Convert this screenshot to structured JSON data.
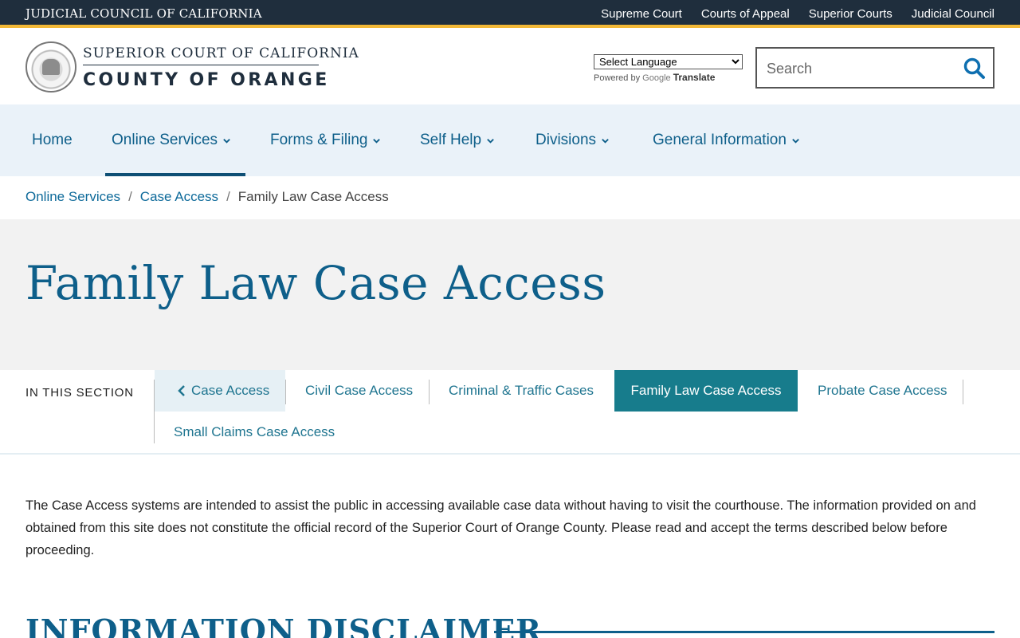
{
  "topbar": {
    "brand": "JUDICIAL COUNCIL OF CALIFORNIA",
    "links": [
      "Supreme Court",
      "Courts of Appeal",
      "Superior Courts",
      "Judicial Council"
    ]
  },
  "header": {
    "court_line1": "SUPERIOR COURT OF CALIFORNIA",
    "court_line2": "COUNTY OF ORANGE",
    "language_select": "Select Language",
    "powered_by": "Powered by",
    "google": "Google",
    "translate": "Translate",
    "search_placeholder": "Search"
  },
  "nav": {
    "items": [
      "Home",
      "Online Services",
      "Forms & Filing",
      "Self Help",
      "Divisions",
      "General Information"
    ],
    "active": "Online Services"
  },
  "breadcrumb": {
    "items": [
      "Online Services",
      "Case Access"
    ],
    "current": "Family Law Case Access",
    "separator": "/"
  },
  "page": {
    "title": "Family Law Case Access"
  },
  "section": {
    "label": "IN THIS SECTION",
    "back": "Case Access",
    "links": [
      "Civil Case Access",
      "Criminal & Traffic Cases",
      "Family Law Case Access",
      "Probate Case Access",
      "Small Claims Case Access"
    ],
    "active": "Family Law Case Access"
  },
  "content": {
    "intro": "The Case Access systems are intended to assist the public in accessing available case data without having to visit the courthouse. The information provided on and obtained from this site does not constitute the official record of the Superior Court of Orange County. Please read and accept the terms described below before proceeding.",
    "disclaimer_heading": "INFORMATION DISCLAIMER"
  },
  "colors": {
    "topbar": "#1f2e3d",
    "accent_gold": "#f2b836",
    "link_blue": "#0e5f8a",
    "active_teal": "#177c8c",
    "nav_bg": "#eaf2f9",
    "hero_bg": "#f2f2f2"
  }
}
